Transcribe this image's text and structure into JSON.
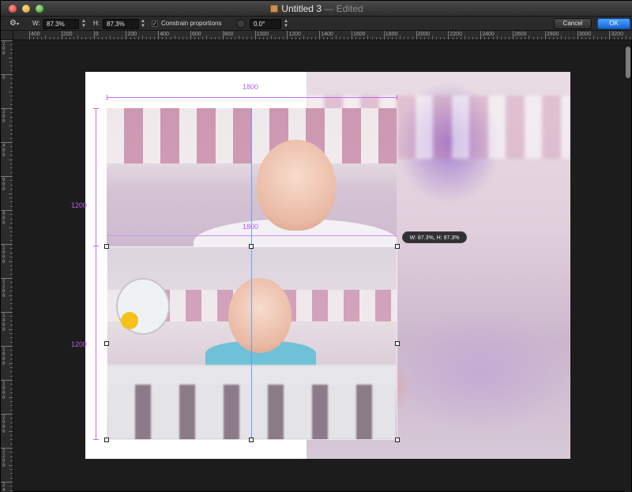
{
  "window": {
    "title": "Untitled 3",
    "status": "— Edited"
  },
  "toolbar": {
    "width_label": "W:",
    "width_value": "87.3%",
    "height_label": "H:",
    "height_value": "87.3%",
    "constrain_label": "Constrain proportions",
    "constrain_checked": "✓",
    "angle_value": "0.0°",
    "cancel_label": "Cancel",
    "ok_label": "OK"
  },
  "ruler": {
    "horizontal": [
      "400",
      "200",
      "0",
      "200",
      "400",
      "600",
      "800",
      "1000",
      "1200",
      "1400",
      "1600",
      "1800",
      "2000",
      "2200",
      "2400",
      "2600",
      "2800",
      "3000",
      "3200"
    ],
    "vertical": [
      "200",
      "0",
      "200",
      "400",
      "600",
      "800",
      "1000",
      "1200",
      "1400",
      "1600",
      "1800",
      "2000",
      "2200",
      "2400"
    ]
  },
  "dimensions": {
    "top_width": "1800",
    "mid_width": "1800",
    "left_height_top": "1200",
    "left_height_bottom": "1200"
  },
  "tooltip": "W: 87.3%, H: 87.3%",
  "colors": {
    "accent": "#1466d4",
    "guide": "#5b9bff",
    "dimension": "#c56cf0"
  }
}
